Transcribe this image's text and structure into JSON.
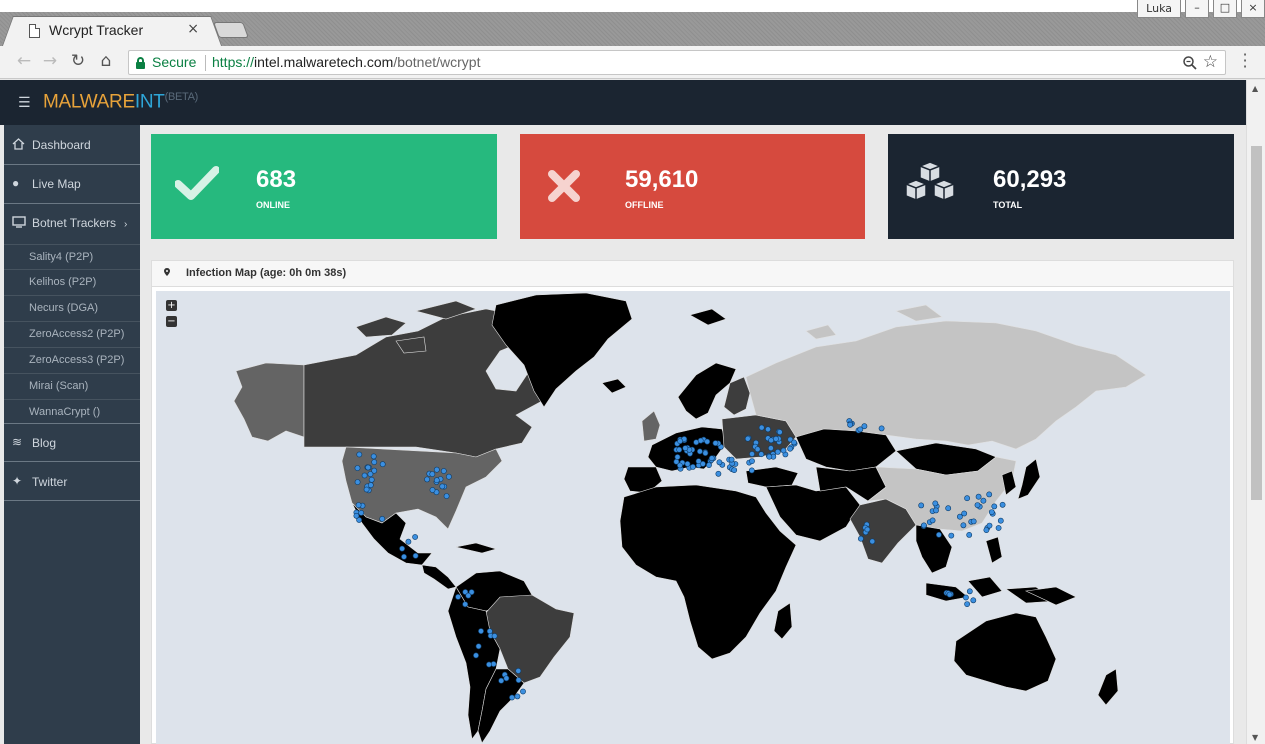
{
  "browser": {
    "tab_title": "Wcrypt Tracker",
    "tab_close": "×",
    "user": "Luka",
    "win_min": "–",
    "win_max": "□",
    "win_close": "×",
    "secure_label": "Secure",
    "url_scheme": "https://",
    "url_host": "intel.malwaretech.com",
    "url_path": "/botnet/wcrypt"
  },
  "navbar": {
    "brand_part1": "MALWARE",
    "brand_part2": "INT",
    "brand_part3": "(BETA)"
  },
  "sidebar": {
    "items": [
      {
        "label": "Dashboard",
        "icon": "home-icon"
      },
      {
        "label": "Live Map",
        "icon": "globe-icon"
      },
      {
        "label": "Botnet Trackers",
        "icon": "monitor-icon"
      },
      {
        "label": "Blog",
        "icon": "rss-icon"
      },
      {
        "label": "Twitter",
        "icon": "twitter-icon"
      }
    ],
    "subitems": [
      "Sality4 (P2P)",
      "Kelihos (P2P)",
      "Necurs (DGA)",
      "ZeroAccess2 (P2P)",
      "ZeroAccess3 (P2P)",
      "Mirai (Scan)",
      "WannaCrypt ()"
    ]
  },
  "stats": {
    "online": {
      "value": "683",
      "label": "ONLINE",
      "color": "#26b97e"
    },
    "offline": {
      "value": "59,610",
      "label": "OFFLINE",
      "color": "#d64a3e"
    },
    "total": {
      "value": "60,293",
      "label": "TOTAL",
      "color": "#1b2531"
    }
  },
  "map": {
    "title": "Infection Map (age: 0h 0m 38s)",
    "zoom_in": "+",
    "zoom_out": "−",
    "land_colors": {
      "high": "#000000",
      "mid": "#3d3d3d",
      "low": "#646464",
      "none": "#c4c4c4"
    },
    "marker_color": "#3b8fe0"
  }
}
